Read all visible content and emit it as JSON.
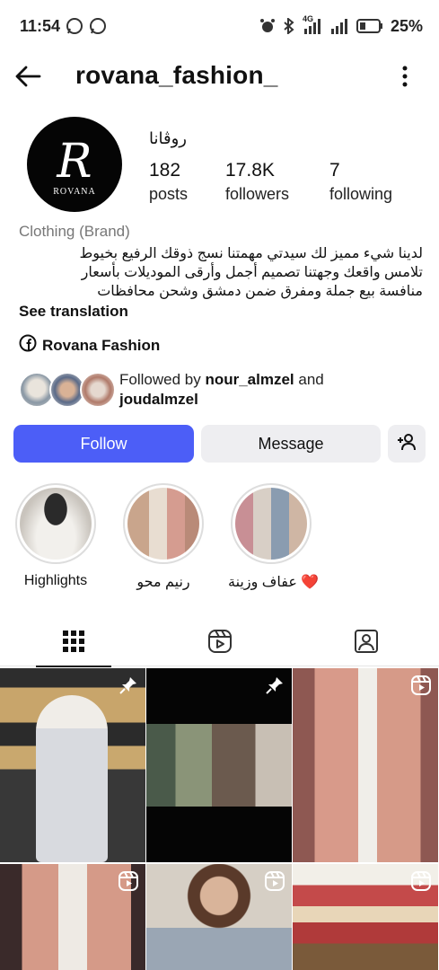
{
  "status_bar": {
    "time": "11:54",
    "battery_percent": "25%",
    "network_label": "4G"
  },
  "header": {
    "username": "rovana_fashion_"
  },
  "profile": {
    "avatar_monogram": "R",
    "avatar_brand": "ROVANA",
    "full_name": "روڤانا",
    "stats": {
      "posts": {
        "value": "182",
        "label": "posts"
      },
      "followers": {
        "value": "17.8K",
        "label": "followers"
      },
      "following": {
        "value": "7",
        "label": "following"
      }
    },
    "category": "Clothing (Brand)",
    "bio_lines": [
      "لدينا شيء مميز لك سيدتي مهمتنا نسج ذوقك الرفيع بخيوط",
      "تلامس واقعك وجهتنا تصميم أجمل وأرقى الموديلات بأسعار",
      "منافسة بيع جملة ومفرق ضمن دمشق وشحن محافظات"
    ],
    "see_translation": "See translation",
    "facebook_link": "Rovana Fashion",
    "followed_by": {
      "prefix": "Followed by",
      "user1": "nour_almzel",
      "and": "and",
      "user2": "joudalmzel"
    }
  },
  "actions": {
    "follow": "Follow",
    "message": "Message"
  },
  "highlights": [
    {
      "label": "Highlights"
    },
    {
      "label": "رنيم محو"
    },
    {
      "label": "عفاف وزينة ❤️"
    }
  ],
  "colors": {
    "follow_button": "#4c5ef7",
    "secondary_button": "#eeeef1"
  }
}
